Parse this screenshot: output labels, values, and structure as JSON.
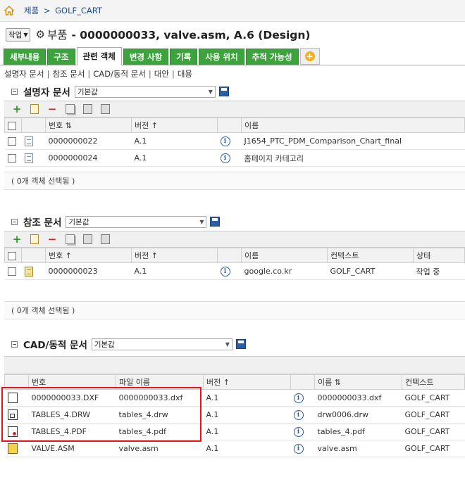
{
  "breadcrumb": {
    "separator": ">",
    "items": [
      "제품",
      "GOLF_CART"
    ]
  },
  "header": {
    "action_menu": "작업",
    "object_type": "부품",
    "title": "- 0000000033, valve.asm, A.6 (Design)"
  },
  "tabs": [
    {
      "label": "세부내용"
    },
    {
      "label": "구조"
    },
    {
      "label": "관련 객체",
      "active": true
    },
    {
      "label": "변경 사항"
    },
    {
      "label": "기록"
    },
    {
      "label": "사용 위치"
    },
    {
      "label": "추적 가능성"
    }
  ],
  "sublinks": [
    "설명자 문서",
    "참조 문서",
    "CAD/동적 문서",
    "대안",
    "대용"
  ],
  "describing_docs": {
    "title": "설명자 문서",
    "view": "기본값",
    "columns": [
      "번호",
      "버전",
      "이름"
    ],
    "rows": [
      {
        "number": "0000000022",
        "version": "A.1",
        "name": "J1654_PTC_PDM_Comparison_Chart_final"
      },
      {
        "number": "0000000024",
        "version": "A.1",
        "name": "홈페이지 카테고리"
      }
    ],
    "status": "( 0개 객체 선택됨 )"
  },
  "reference_docs": {
    "title": "참조 문서",
    "view": "기본값",
    "columns": [
      "번호",
      "버전",
      "이름",
      "컨텍스트",
      "상태"
    ],
    "rows": [
      {
        "number": "0000000023",
        "version": "A.1",
        "name": "google.co.kr",
        "context": "GOLF_CART",
        "state": "작업 중"
      }
    ],
    "status": "( 0개 객체 선택됨 )"
  },
  "cad_docs": {
    "title": "CAD/동적 문서",
    "view": "기본값",
    "columns": [
      "번호",
      "파일 이름",
      "버전",
      "이름",
      "컨텍스트"
    ],
    "rows": [
      {
        "icon": "dxf-file-icon",
        "number": "0000000033.DXF",
        "file": "0000000033.dxf",
        "version": "A.1",
        "name": "0000000033.dxf",
        "context": "GOLF_CART"
      },
      {
        "icon": "drw-file-icon",
        "number": "TABLES_4.DRW",
        "file": "tables_4.drw",
        "version": "A.1",
        "name": "drw0006.drw",
        "context": "GOLF_CART"
      },
      {
        "icon": "pdf-file-icon",
        "number": "TABLES_4.PDF",
        "file": "tables_4.pdf",
        "version": "A.1",
        "name": "tables_4.pdf",
        "context": "GOLF_CART"
      },
      {
        "icon": "assembly-file-icon",
        "number": "VALVE.ASM",
        "file": "valve.asm",
        "version": "A.1",
        "name": "valve.asm",
        "context": "GOLF_CART"
      }
    ]
  },
  "colors": {
    "tab_green": "#3da33d",
    "link_blue": "#1a4a96",
    "highlight_red": "#e8131b"
  }
}
